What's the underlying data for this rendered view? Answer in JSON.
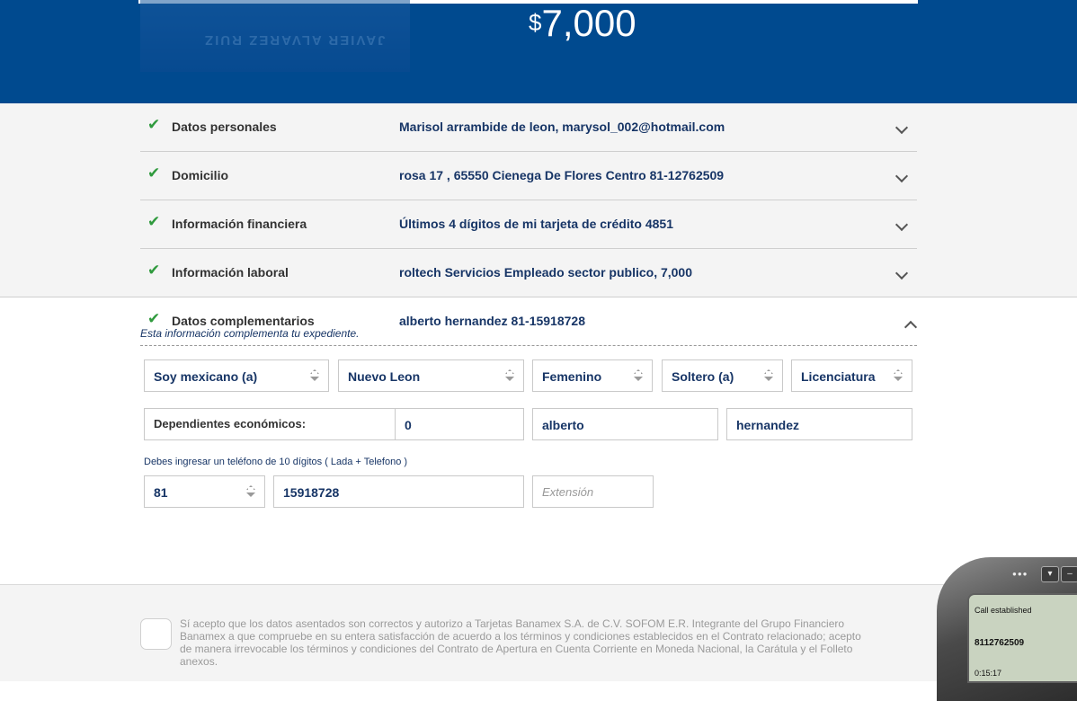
{
  "header": {
    "currency_symbol": "$",
    "amount": "7,000",
    "card_text": "JAVIER ALVAREZ RUIZ"
  },
  "sections": [
    {
      "label": "Datos personales",
      "summary": "Marisol arrambide de leon, marysol_002@hotmail.com"
    },
    {
      "label": "Domicilio",
      "summary": "rosa 17 , 65550 Cienega De Flores Centro 81-12762509"
    },
    {
      "label": "Información financiera",
      "summary": "Últimos 4 dígitos de mi tarjeta de crédito 4851"
    },
    {
      "label": "Información laboral",
      "summary": "roltech Servicios Empleado sector publico, 7,000"
    }
  ],
  "complementary": {
    "label": "Datos complementarios",
    "summary": "alberto hernandez 81-15918728",
    "subtitle": "Esta información complementa tu expediente."
  },
  "form": {
    "nationality": "Soy mexicano (a)",
    "state": "Nuevo Leon",
    "gender": "Femenino",
    "marital_status": "Soltero (a)",
    "education": "Licenciatura",
    "dependents_label": "Dependientes económicos:",
    "dependents_value": "0",
    "first_name": "alberto",
    "last_name": "hernandez",
    "phone_hint": "Debes ingresar un teléfono de 10 dígitos ( Lada + Telefono )",
    "lada": "81",
    "phone": "15918728",
    "extension_placeholder": "Extensión"
  },
  "footer": {
    "terms": "Sí acepto que los datos asentados son correctos y autorizo a Tarjetas Banamex S.A. de C.V. SOFOM E.R. Integrante del Grupo Financiero Banamex a que compruebe en su entera satisfacción de acuerdo a los términos y condiciones establecidos en el Contrato relacionado; acepto de manera irrevocable los términos y condiciones del Contrato de Apertura en Cuenta Corriente en Moneda Nacional, la Carátula y el Folleto anexos."
  },
  "softphone": {
    "status": "Call established",
    "number": "8112762509",
    "timer": "0:15:17"
  },
  "colors": {
    "brand_blue": "#004a8f",
    "check_green": "#2f9a3d",
    "value_navy": "#173566"
  },
  "icons": [
    "check-icon",
    "chevron-down-icon",
    "chevron-up-icon",
    "select-arrows-icon"
  ]
}
